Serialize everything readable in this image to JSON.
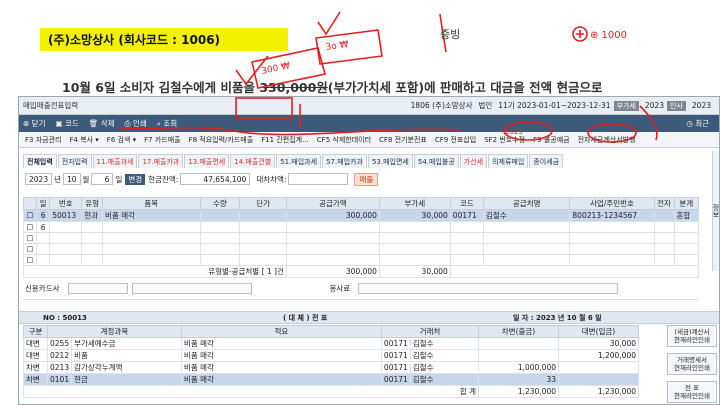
{
  "banner": "(주)소망상사 (회사코드 : 1006)",
  "question": {
    "before": "10월 6일   소비자 김철수에게 비품을 ",
    "amount": "330,000원",
    "after": "(부가가치세 포함)에 판매하고 대금을 전액 현금으로"
  },
  "handwriting": {
    "a": "300 ₩",
    "b": "3o ₩",
    "c": "증빙",
    "d": "⊕ 1000",
    "e": "2023"
  },
  "titlebar": {
    "title": "매입매출전표입력",
    "company": "1806 (주)소망상사",
    "period_label": "법인",
    "fiscal": "11기 2023-01-01~2023-12-31",
    "chip1": "부가세",
    "year": "2023",
    "chip2": "인사",
    "year2": "2023"
  },
  "toolbar": {
    "close": "닫기",
    "code": "코드",
    "delete": "삭제",
    "print": "인쇄",
    "search": "조회",
    "recent": "최근"
  },
  "fnbar": [
    "F3 자금관리",
    "F4 복사 ▾",
    "F6 검색 ▾",
    "F7 카드매출",
    "F8 적요입력/카드매출",
    "F11 간편집계...",
    "CF5 삭제한데이터",
    "CF8 전기분전표",
    "CF9 전표삽입",
    "SF2 번호수정",
    "F9 불공예금",
    "전자세금계산서발행"
  ],
  "tabs": [
    {
      "label": "전체입력",
      "active": true
    },
    {
      "label": "전자입력"
    },
    {
      "label": "11.매출과세"
    },
    {
      "label": "17.매출카과"
    },
    {
      "label": "13.매출면세"
    },
    {
      "label": "14.매출건별"
    },
    {
      "label": "51.매입과세"
    },
    {
      "label": "57.매입카과"
    },
    {
      "label": "53.매입면세"
    },
    {
      "label": "54.매입불공"
    },
    {
      "label": "가산세"
    },
    {
      "label": "의제류매입"
    },
    {
      "label": "종이세금"
    }
  ],
  "datebar": {
    "year": "2023",
    "year_unit": "년",
    "month": "10",
    "month_unit": "월",
    "day": "6",
    "day_unit": "일",
    "change": "변경",
    "cash_label": "현금잔액:",
    "cash": "47,654,100",
    "balance_label": "대차차액:",
    "balance": "",
    "sales": "매출"
  },
  "grid1": {
    "headers": [
      "일",
      "번호",
      "유형",
      "품목",
      "수량",
      "단가",
      "공급가액",
      "부가세",
      "코드",
      "공급처명",
      "사업/주민번호",
      "전자",
      "분개"
    ],
    "rows": [
      {
        "day": "6",
        "no": "50013",
        "type": "현과",
        "item": "비품 매각",
        "qty": "",
        "price": "",
        "supply": "300,000",
        "vat": "30,000",
        "code": "00171",
        "vendor": "김철수",
        "bizno": "800213-1234567",
        "e": "",
        "journal": "혼합"
      },
      {
        "day": "6",
        "no": "",
        "type": "",
        "item": "",
        "qty": "",
        "price": "",
        "supply": "",
        "vat": "",
        "code": "",
        "vendor": "",
        "bizno": "",
        "e": "",
        "journal": ""
      }
    ],
    "subtotal_label": "유형별-공급처별 [ 1 ]건",
    "subtotal_supply": "300,000",
    "subtotal_vat": "30,000"
  },
  "card": {
    "label": "신용카드사",
    "service_label": "봉사료"
  },
  "voucher": {
    "no_label": "NO : 50013",
    "type": "( 대 체 )   전   표",
    "date": "일 자 : 2023 년 10 월   6 일"
  },
  "grid2": {
    "headers": [
      "구분",
      "계정과목",
      "적요",
      "거래처",
      "차변(출금)",
      "대변(입금)"
    ],
    "rows": [
      {
        "div": "대변",
        "code": "0255",
        "acct": "부가세예수금",
        "desc": "비품 매각",
        "pcode": "00171",
        "partner": "김철수",
        "debit": "",
        "credit": "30,000"
      },
      {
        "div": "대변",
        "code": "0212",
        "acct": "비품",
        "desc": "비품 매각",
        "pcode": "00171",
        "partner": "김철수",
        "debit": "",
        "credit": "1,200,000"
      },
      {
        "div": "차변",
        "code": "0213",
        "acct": "감가상각누계액",
        "desc": "비품 매각",
        "pcode": "00171",
        "partner": "김철수",
        "debit": "1,000,000",
        "credit": ""
      },
      {
        "div": "차변",
        "code": "0101",
        "acct": "현금",
        "desc": "비품 매각",
        "pcode": "00171",
        "partner": "김철수",
        "debit": "33",
        "credit": ""
      }
    ],
    "total_label": "합   계",
    "total_debit": "1,230,000",
    "total_credit": "1,230,000"
  },
  "side_buttons": [
    {
      "line1": "(세금)계산서",
      "line2": "현재라인인쇄"
    },
    {
      "line1": "거래명세서",
      "line2": "현재라인인쇄"
    },
    {
      "line1": "전 표",
      "line2": "현재라인인쇄"
    }
  ],
  "rightcol": "정보"
}
